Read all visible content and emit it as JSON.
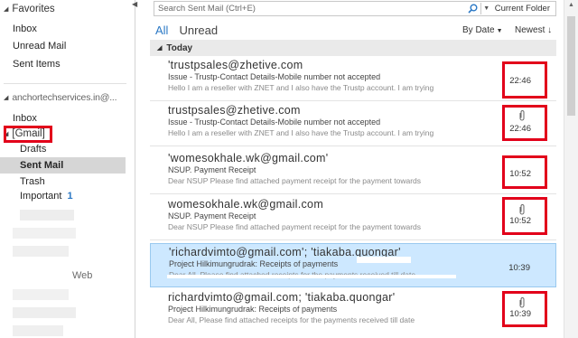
{
  "nav": {
    "favorites_header": "Favorites",
    "favorites": [
      "Inbox",
      "Unread Mail",
      "Sent Items"
    ],
    "account": "anchortechservices.in@...",
    "account_items": [
      "Inbox"
    ],
    "gmail_label": "[Gmail]",
    "gmail_items": [
      {
        "label": "Drafts"
      },
      {
        "label": "Sent Mail",
        "selected": true
      },
      {
        "label": "Trash"
      },
      {
        "label": "Important",
        "count": "1"
      }
    ],
    "partial_item": "Web"
  },
  "search": {
    "placeholder": "Search Sent Mail (Ctrl+E)",
    "scope": "Current Folder"
  },
  "filters": {
    "all": "All",
    "unread": "Unread",
    "sort_by": "By Date",
    "order": "Newest"
  },
  "group": {
    "label": "Today"
  },
  "mails": [
    {
      "from": "'trustpsales@zhetive.com",
      "subject": "Issue - Trustp-Contact Details-Mobile number not accepted",
      "preview": "Hello   I am a reseller with ZNET and I also have the Trustp account.   I am trying",
      "time": "22:46",
      "attachment": false
    },
    {
      "from": "trustpsales@zhetive.com",
      "subject": "Issue - Trustp-Contact Details-Mobile number not accepted",
      "preview": "Hello   I am a reseller with ZNET and I also have the Trustp account.   I am trying",
      "time": "22:46",
      "attachment": true
    },
    {
      "from": "'womesokhale.wk@gmail.com'",
      "subject": "NSUP. Payment Receipt",
      "preview": "Dear NSUP   Please find attached payment receipt for the payment towards",
      "time": "10:52",
      "attachment": false
    },
    {
      "from": "womesokhale.wk@gmail.com",
      "subject": "NSUP. Payment Receipt",
      "preview": "Dear NSUP   Please find attached payment receipt for the payment towards",
      "time": "10:52",
      "attachment": true
    },
    {
      "from": "'richardvimto@gmail.com'; 'tiakaba.quongar'",
      "subject": "Project  Hilkimungrudrak: Receipts of payments",
      "preview": "Dear All,   Please find attached receipts for the payments received till date",
      "time": "10:39",
      "attachment": false,
      "selected": true
    },
    {
      "from": "richardvimto@gmail.com; 'tiakaba.quongar'",
      "subject": "Project  Hilkimungrudrak: Receipts of payments",
      "preview": "Dear All,   Please find attached receipts for the payments received till date",
      "time": "10:39",
      "attachment": true
    }
  ],
  "colors": {
    "accent": "#2b78c5",
    "highlight_box": "#e2001a",
    "selected_row": "#cde8ff"
  }
}
